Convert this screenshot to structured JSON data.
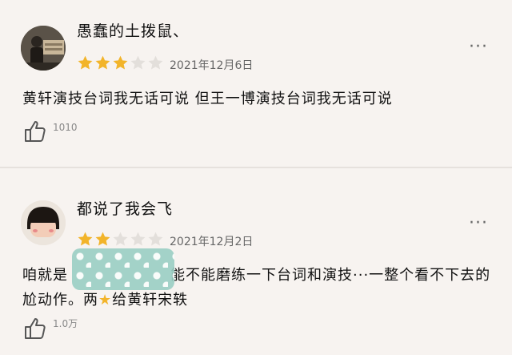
{
  "reviews": [
    {
      "username": "愚蠢的土拨鼠、",
      "rating": 3,
      "max_rating": 5,
      "date": "2021年12月6日",
      "text": "黄轩演技台词我无话可说 但王一博演技台词我无话可说",
      "likes": "1010",
      "more_icon": "···"
    },
    {
      "username": "都说了我会飞",
      "rating": 2,
      "max_rating": 5,
      "date": "2021年12月2日",
      "text_before": "咱就是",
      "text_after": "能不能磨练一下台词和演技···一整个看不下去的尬动作。两",
      "star_emoji": "★",
      "text_end": "给黄轩宋轶",
      "likes": "1.0万",
      "more_icon": "···"
    }
  ],
  "colors": {
    "star_filled": "#f2b42a",
    "star_empty": "#e3dfdb",
    "background": "#f7f3f0"
  }
}
